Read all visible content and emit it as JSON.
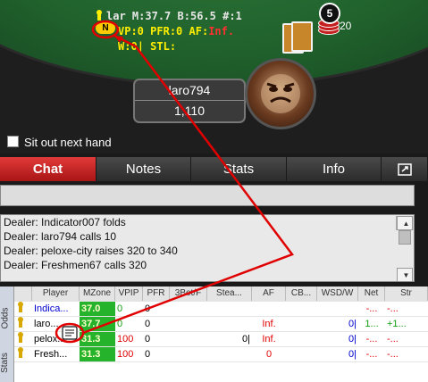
{
  "hud": {
    "line1": {
      "name": "lar",
      "mzone": "M:37.7",
      "bb": "B:56.5",
      "rank": "#:1"
    },
    "line2": {
      "badge": "N",
      "vpip": "VP:0",
      "pfr": "PFR:0",
      "af": "AF:",
      "af_val": "Inf."
    },
    "line3": {
      "w": "W:0",
      "stl": "STL:"
    }
  },
  "chips": {
    "label": "5",
    "count": "20"
  },
  "seat": {
    "name": "laro794",
    "stack": "1,110"
  },
  "sitout": {
    "label": "Sit out next hand",
    "checked": false
  },
  "tabs": [
    {
      "label": "Chat",
      "active": true
    },
    {
      "label": "Notes"
    },
    {
      "label": "Stats"
    },
    {
      "label": "Info"
    }
  ],
  "chat_input": {
    "value": ""
  },
  "chat_log": [
    "Dealer: Indicator007 folds",
    "Dealer: laro794 calls 10",
    "Dealer: peloxe-city raises 320 to 340",
    "Dealer: Freshmen67 calls 320"
  ],
  "side_tabs": [
    "Odds",
    "Stats"
  ],
  "table": {
    "columns": [
      "Player",
      "MZone",
      "VPIP",
      "PFR",
      "3Bet/F",
      "Stea...",
      "AF",
      "CB...",
      "WSD/W",
      "Net",
      "Str"
    ],
    "rows": [
      {
        "player": "Indica...",
        "mzone": "37.0",
        "vpip": "0",
        "pfr": "0",
        "bet3": "",
        "steal": "",
        "af": "",
        "cb": "",
        "wsd": "",
        "net": "-...",
        "str": "-..."
      },
      {
        "player": "laro...",
        "mzone": "37.7",
        "vpip": "0",
        "pfr": "0",
        "bet3": "",
        "steal": "",
        "af": "Inf.",
        "cb": "",
        "wsd": "0|",
        "net": "1...",
        "str": "+1..."
      },
      {
        "player": "pelox...",
        "mzone": "31.3",
        "vpip": "100",
        "pfr": "0",
        "bet3": "",
        "steal": "0|",
        "af": "Inf.",
        "cb": "",
        "wsd": "0|",
        "net": "-...",
        "str": "-..."
      },
      {
        "player": "Fresh...",
        "mzone": "31.3",
        "vpip": "100",
        "pfr": "0",
        "bet3": "",
        "steal": "",
        "af": "0",
        "cb": "",
        "wsd": "0|",
        "net": "-...",
        "str": "-..."
      }
    ]
  },
  "colors": {
    "accent": "#d42020",
    "felt": "#1f5f2b",
    "mzone": "#26b32c",
    "hud_yellow": "#ffee00"
  }
}
